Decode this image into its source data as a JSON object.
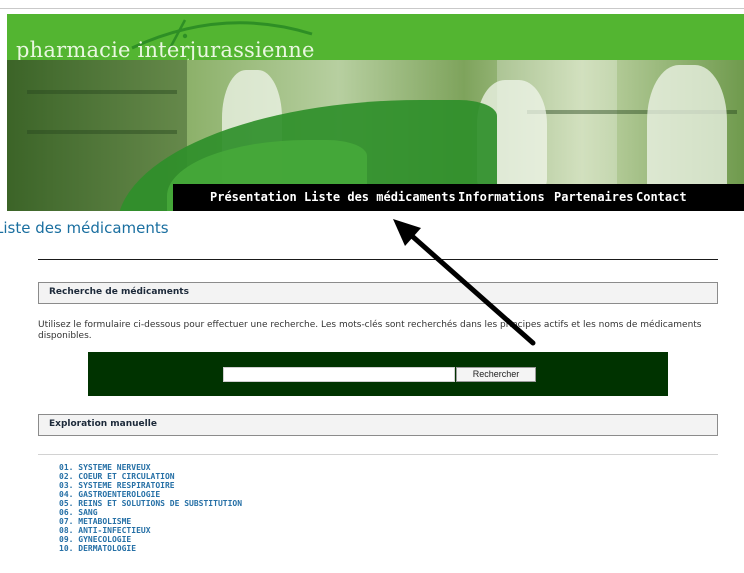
{
  "header": {
    "site_title": "pharmacie interjurassienne",
    "nav_items": [
      "Présentation",
      "Liste des médicaments",
      "Informations",
      "Partenaires",
      "Contact"
    ]
  },
  "page": {
    "title": "Liste des médicaments"
  },
  "search_section": {
    "heading": "Recherche de médicaments",
    "intro": "Utilisez le formulaire ci-dessous pour effectuer une recherche. Les mots-clés sont recherchés dans les principes actifs et les noms de médicaments disponibles.",
    "input_value": "",
    "button_label": "Rechercher"
  },
  "manual_section": {
    "heading": "Exploration manuelle",
    "categories": [
      "01. SYSTEME NERVEUX",
      "02. COEUR ET CIRCULATION",
      "03. SYSTEME RESPIRATOIRE",
      "04. GASTROENTEROLOGIE",
      "05. REINS ET SOLUTIONS DE SUBSTITUTION",
      "06. SANG",
      "07. METABOLISME",
      "08. ANTI-INFECTIEUX",
      "09. GYNECOLOGIE",
      "10. DERMATOLOGIE"
    ]
  },
  "colors": {
    "brand_green": "#53b531",
    "nav_bg": "#000000",
    "search_panel_bg": "#003300",
    "link_blue": "#2670a6",
    "title_blue": "#1a6fa0"
  },
  "icons": [
    "annotation-arrow-icon",
    "logo-arc-icon"
  ]
}
